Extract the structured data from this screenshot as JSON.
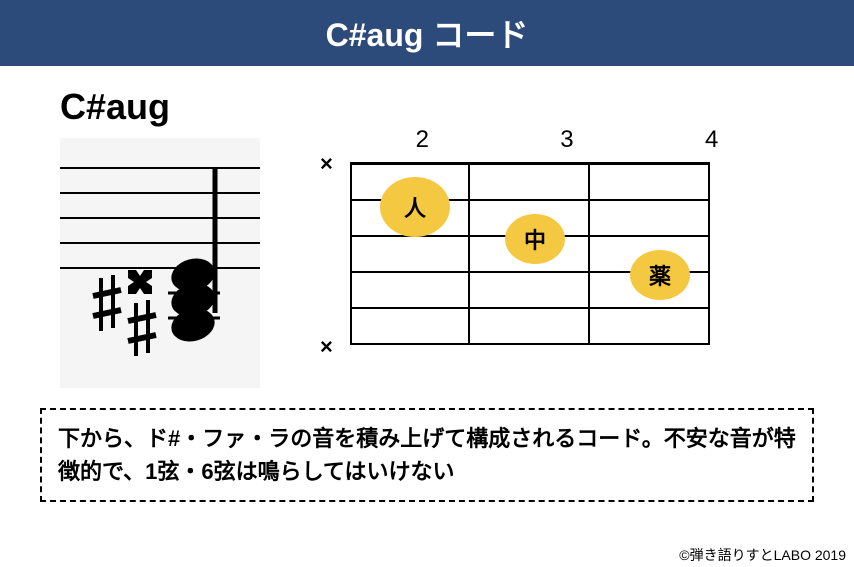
{
  "header": {
    "title": "C#aug コード"
  },
  "chord": {
    "name": "C#aug"
  },
  "fretboard": {
    "fret_labels": [
      "2",
      "3",
      "4"
    ],
    "mute_marks": [
      "×",
      "×"
    ],
    "fingers": [
      {
        "label": "人",
        "string": 2,
        "fret": 1
      },
      {
        "label": "中",
        "string": 3,
        "fret": 2
      },
      {
        "label": "薬",
        "string": 4,
        "fret": 3
      }
    ]
  },
  "description": "下から、ド#・ファ・ラの音を積み上げて構成されるコード。不安な音が特徴的で、1弦・6弦は鳴らしてはいけない",
  "copyright": "©弾き語りすとLABO 2019",
  "chart_data": {
    "type": "chord-diagram",
    "chord_name": "C#aug",
    "notes": [
      "C#",
      "F",
      "A"
    ],
    "starting_fret": 2,
    "fret_count": 3,
    "strings": 6,
    "muted_strings": [
      1,
      6
    ],
    "fingering": [
      {
        "string": 5,
        "fret": 2,
        "finger": "index"
      },
      {
        "string": 4,
        "fret": 3,
        "finger": "middle"
      },
      {
        "string": 3,
        "fret": 4,
        "finger": "ring"
      }
    ]
  }
}
